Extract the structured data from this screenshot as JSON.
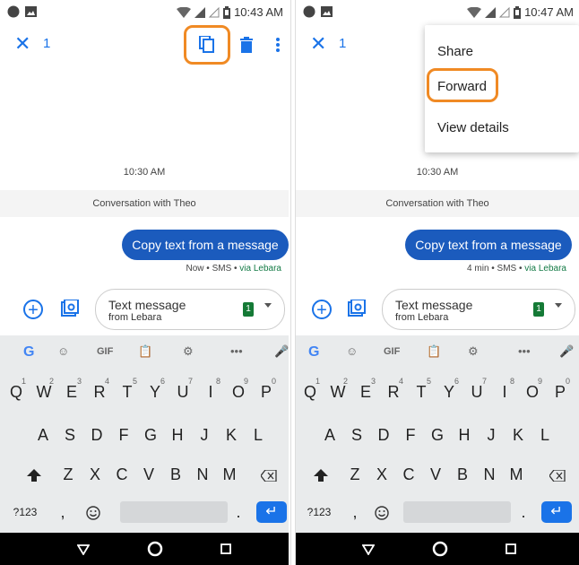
{
  "left_screen": {
    "status_time": "10:43 AM",
    "selected_count": "1",
    "timestamp": "10:30 AM",
    "conversation_label": "Conversation with Theo",
    "bubble_text": "Copy text from a message",
    "meta_prefix": "Now • SMS • ",
    "meta_via": "via Lebara",
    "compose_placeholder": "Text message",
    "compose_sub": "from Lebara",
    "sim_label": "1"
  },
  "right_screen": {
    "status_time": "10:47 AM",
    "selected_count": "1",
    "menu": {
      "share": "Share",
      "forward": "Forward",
      "view_details": "View details"
    },
    "timestamp": "10:30 AM",
    "conversation_label": "Conversation with Theo",
    "bubble_text": "Copy text from a message",
    "meta_prefix": "4 min • SMS • ",
    "meta_via": "via Lebara",
    "compose_placeholder": "Text message",
    "compose_sub": "from Lebara",
    "sim_label": "1"
  },
  "keyboard": {
    "suggestions": [
      "G",
      "☺",
      "GIF",
      "📋",
      "⚙",
      "•••",
      "🎤"
    ],
    "row1": [
      "Q",
      "W",
      "E",
      "R",
      "T",
      "Y",
      "U",
      "I",
      "O",
      "P"
    ],
    "row1_numbers": [
      "1",
      "2",
      "3",
      "4",
      "5",
      "6",
      "7",
      "8",
      "9",
      "0"
    ],
    "row2": [
      "A",
      "S",
      "D",
      "F",
      "G",
      "H",
      "J",
      "K",
      "L"
    ],
    "row3": [
      "Z",
      "X",
      "C",
      "V",
      "B",
      "N",
      "M"
    ],
    "num_key": "?123",
    "comma": ",",
    "period": "."
  },
  "colors": {
    "accent": "#1a73e8",
    "bubble": "#1b5bbd",
    "highlight": "#f08a24",
    "via": "#137a45"
  }
}
